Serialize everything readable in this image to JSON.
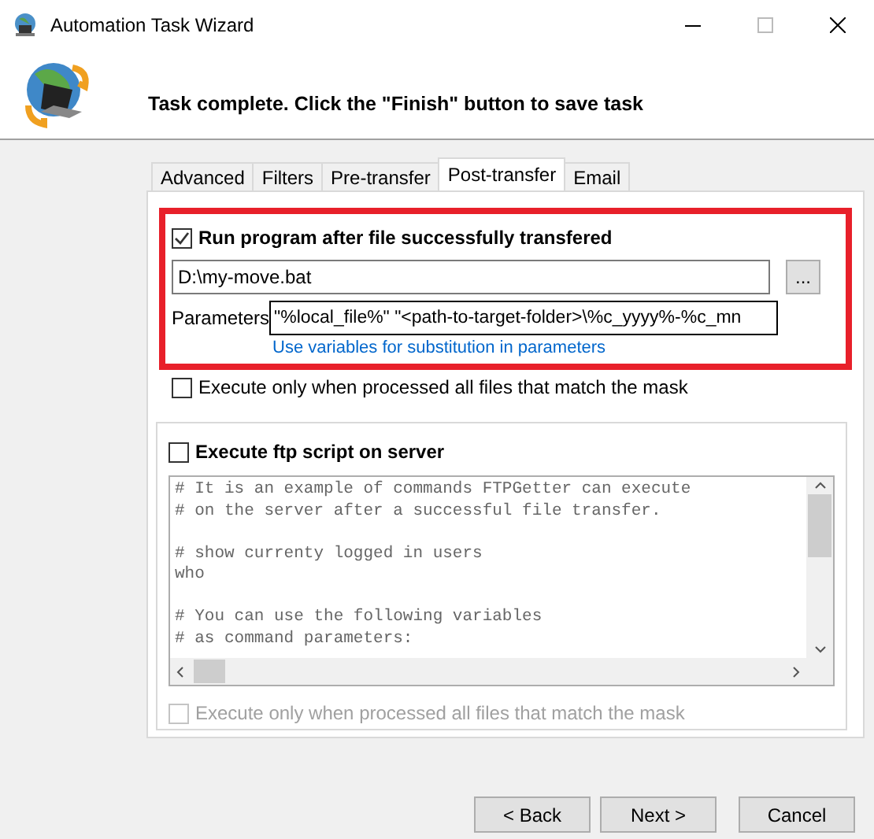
{
  "window": {
    "title": "Automation Task Wizard"
  },
  "header": {
    "message": "Task complete. Click the \"Finish\" button to save task"
  },
  "tabs": [
    {
      "label": "Advanced",
      "selected": false
    },
    {
      "label": "Filters",
      "selected": false
    },
    {
      "label": "Pre-transfer",
      "selected": false
    },
    {
      "label": "Post-transfer",
      "selected": true
    },
    {
      "label": "Email",
      "selected": false
    }
  ],
  "run_program": {
    "label": "Run program after file successfully transfered",
    "checked": true,
    "highlighted": true,
    "program_path": "D:\\my-move.bat",
    "browse_button": "...",
    "parameters_label": "Parameters",
    "parameters": "\"%local_file%\" \"<path-to-target-folder>\\%c_yyyy%-%c_mn",
    "variables_link": "Use variables for substitution in parameters"
  },
  "execute_only_1": {
    "label": "Execute only when processed all files that match the mask",
    "checked": false,
    "disabled": false
  },
  "ftp_script": {
    "label": "Execute ftp script on server",
    "checked": false,
    "paragraphs": [
      [
        "# It is an example of commands FTPGetter can execute",
        "# on the server after a successful file transfer."
      ],
      [
        "# show currenty logged in users",
        "who"
      ],
      [
        "# You can use the following variables",
        "# as command parameters:"
      ]
    ]
  },
  "execute_only_2": {
    "label": "Execute only when processed all files that match the mask",
    "checked": false,
    "disabled": true
  },
  "buttons": [
    "< Back",
    "Next >",
    "Cancel"
  ]
}
